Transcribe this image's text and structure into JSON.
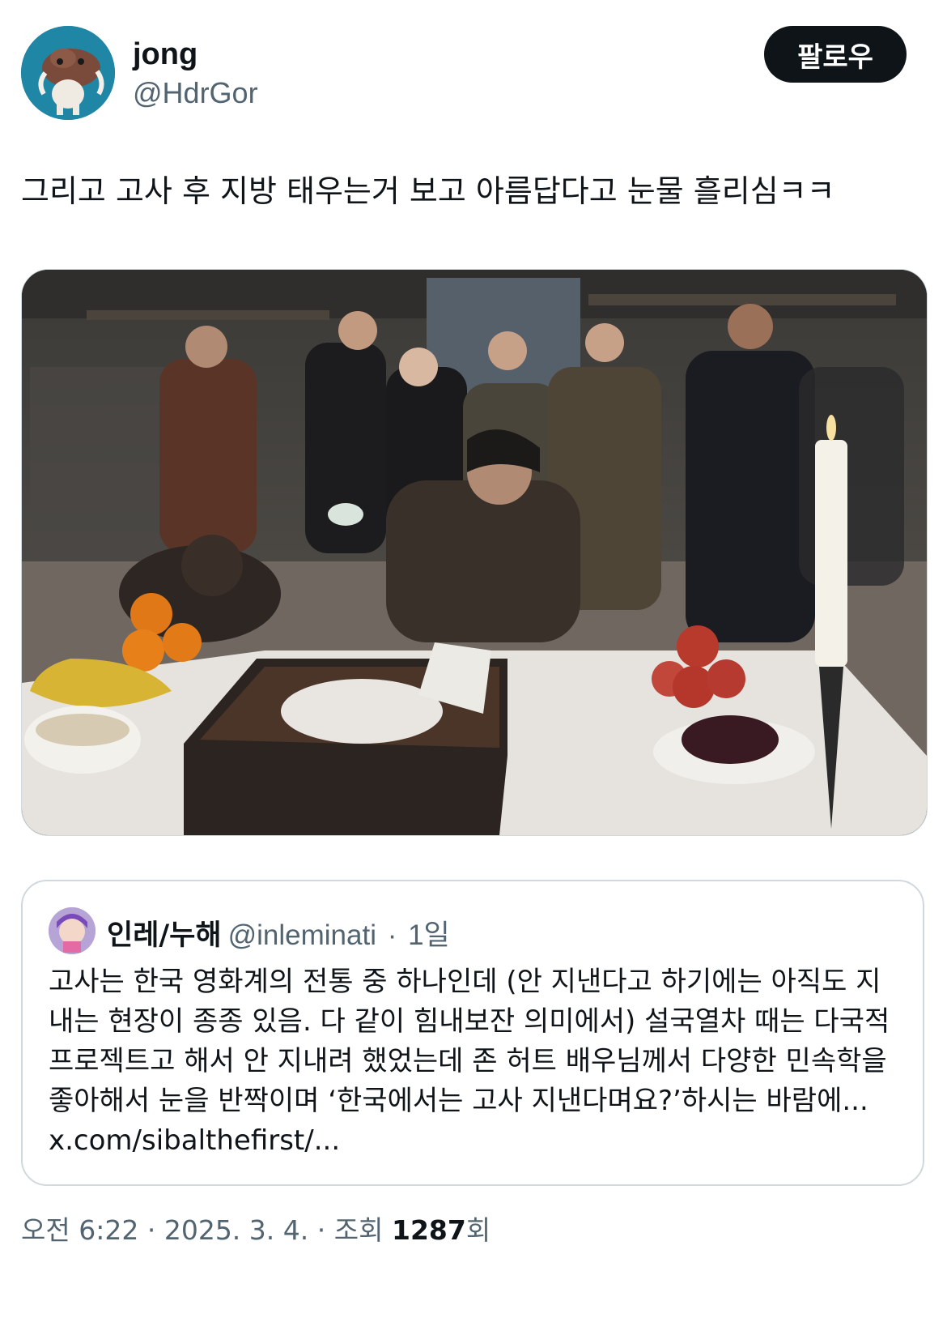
{
  "author": {
    "name": "jong",
    "handle": "@HdrGor"
  },
  "follow_label": "팔로우",
  "tweet_text": "그리고 고사 후 지방 태우는거 보고 아름답다고 눈물 흘리심ㅋㅋ",
  "media": {
    "alt": "photo",
    "colors": {
      "table": "#e8e6e1",
      "background": "#3a3936",
      "candle": "#f4f1e8"
    }
  },
  "quote": {
    "name": "인레/누해",
    "handle": "@inleminati",
    "separator": "·",
    "time": "1일",
    "body": "고사는 한국 영화계의 전통 중 하나인데 (안 지낸다고 하기에는 아직도 지내는 현장이 종종 있음. 다 같이 힘내보잔 의미에서) 설국열차 때는 다국적 프로젝트고 해서 안 지내려 했었는데 존 허트 배우님께서 다양한 민속학을 좋아해서 눈을 반짝이며 ‘한국에서는 고사 지낸다며요?’하시는 바람에... ",
    "link": "x.com/sibalthefirst/..."
  },
  "meta": {
    "time": "오전 6:22",
    "dot1": "·",
    "date": "2025. 3. 4.",
    "dot2": "·",
    "views_label": "조회",
    "views_count": "1287",
    "views_suffix": "회"
  }
}
